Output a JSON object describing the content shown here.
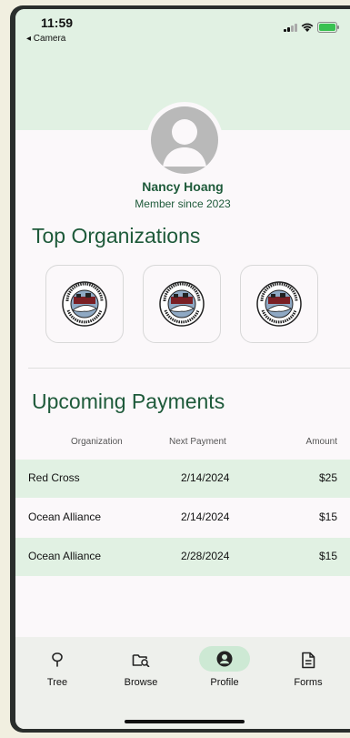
{
  "status": {
    "time": "11:59",
    "back_label": "◂ Camera"
  },
  "profile": {
    "name": "Nancy Hoang",
    "member_since": "Member since 2023"
  },
  "top_orgs": {
    "title": "Top Organizations",
    "items": [
      {
        "name": "Ocean Alliance",
        "logo_text_top": "WWW.WHALE.ORG",
        "logo_text_bottom": "OCEAN ALLIANCE"
      },
      {
        "name": "Ocean Alliance",
        "logo_text_top": "WWW.WHALE.ORG",
        "logo_text_bottom": "OCEAN ALLIANCE"
      },
      {
        "name": "Ocean Alliance",
        "logo_text_top": "WWW.WHALE.ORG",
        "logo_text_bottom": "OCEAN ALLIANCE"
      }
    ]
  },
  "payments": {
    "title": "Upcoming Payments",
    "columns": [
      "Organization",
      "Next Payment",
      "Amount"
    ],
    "rows": [
      {
        "organization": "Red Cross",
        "next_payment": "2/14/2024",
        "amount": "$25"
      },
      {
        "organization": "Ocean Alliance",
        "next_payment": "2/14/2024",
        "amount": "$15"
      },
      {
        "organization": "Ocean Alliance",
        "next_payment": "2/28/2024",
        "amount": "$15"
      }
    ]
  },
  "tabs": [
    {
      "label": "Tree",
      "icon": "tree-icon",
      "active": false
    },
    {
      "label": "Browse",
      "icon": "browse-icon",
      "active": false
    },
    {
      "label": "Profile",
      "icon": "profile-icon",
      "active": true
    },
    {
      "label": "Forms",
      "icon": "forms-icon",
      "active": false
    }
  ],
  "colors": {
    "accent": "#1e5a3a",
    "light_green": "#e1f1e3",
    "active_pill": "#cde9d4"
  }
}
